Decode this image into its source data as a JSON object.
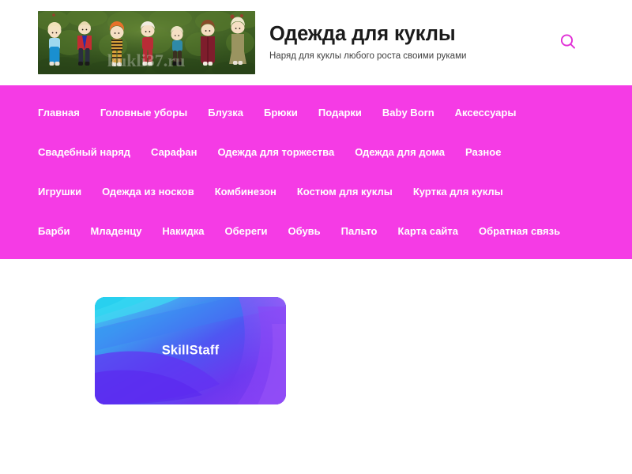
{
  "header": {
    "title": "Одежда для куклы",
    "tagline": "Наряд для куклы любого роста своими руками",
    "logo_alt": "Куклы в вязаной одежде",
    "logo_watermark": "kukli37.ru",
    "search_icon": "search-icon",
    "search_label": "Поиск"
  },
  "colors": {
    "nav_background": "#f53be5",
    "accent": "#e12fd6",
    "title": "#1b1b1b",
    "nav_link": "#ffffff",
    "page_background": "#ffffff",
    "card_gradient_start": "#22d3ee",
    "card_gradient_mid": "#3b82f6",
    "card_gradient_end": "#7c3aed"
  },
  "nav": {
    "rows": [
      [
        {
          "label": "Главная"
        },
        {
          "label": "Головные уборы"
        },
        {
          "label": "Блузка"
        },
        {
          "label": "Брюки"
        },
        {
          "label": "Подарки"
        },
        {
          "label": "Baby Born"
        },
        {
          "label": "Аксессуары"
        }
      ],
      [
        {
          "label": "Свадебный наряд"
        },
        {
          "label": "Сарафан"
        },
        {
          "label": "Одежда для торжества"
        },
        {
          "label": "Одежда для дома"
        },
        {
          "label": "Разное"
        }
      ],
      [
        {
          "label": "Игрушки"
        },
        {
          "label": "Одежда из носков"
        },
        {
          "label": "Комбинезон"
        },
        {
          "label": "Костюм для куклы"
        },
        {
          "label": "Куртка для куклы"
        }
      ],
      [
        {
          "label": "Барби"
        },
        {
          "label": "Младенцу"
        },
        {
          "label": "Накидка"
        },
        {
          "label": "Обереги"
        },
        {
          "label": "Обувь"
        },
        {
          "label": "Пальто"
        },
        {
          "label": "Карта сайта"
        },
        {
          "label": "Обратная связь"
        }
      ]
    ]
  },
  "main": {
    "promo": {
      "label": "SkillStaff"
    }
  }
}
